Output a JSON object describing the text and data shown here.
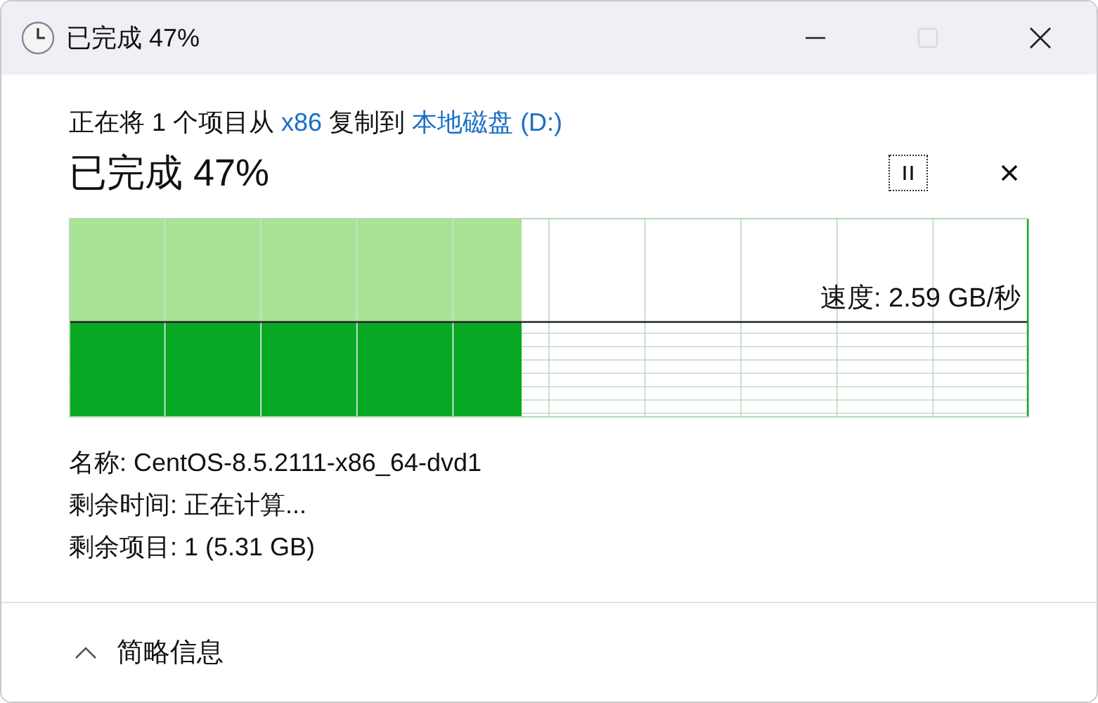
{
  "window": {
    "title": "已完成 47%",
    "buttons": [
      {
        "kind": "minimize",
        "disabled": false
      },
      {
        "kind": "maximize",
        "disabled": true
      },
      {
        "kind": "close",
        "disabled": false
      }
    ]
  },
  "status": [
    {
      "kind": "text",
      "text": "正在将 1 个项目从 "
    },
    {
      "kind": "link",
      "text": "x86"
    },
    {
      "kind": "text",
      "text": " 复制到 "
    },
    {
      "kind": "link",
      "text": "本地磁盘 (D:)"
    }
  ],
  "heading": "已完成 47%",
  "pause_button": {
    "focused": true
  },
  "progress": {
    "level": 0.47,
    "speed": "速度: 2.59 GB/秒"
  },
  "details": [
    "名称: CentOS-8.5.2111-x86_64-dvd1",
    "剩余时间: 正在计算...",
    "剩余项目: 1 (5.31 GB)"
  ],
  "footer": {
    "label": "简略信息",
    "expanded": true
  }
}
